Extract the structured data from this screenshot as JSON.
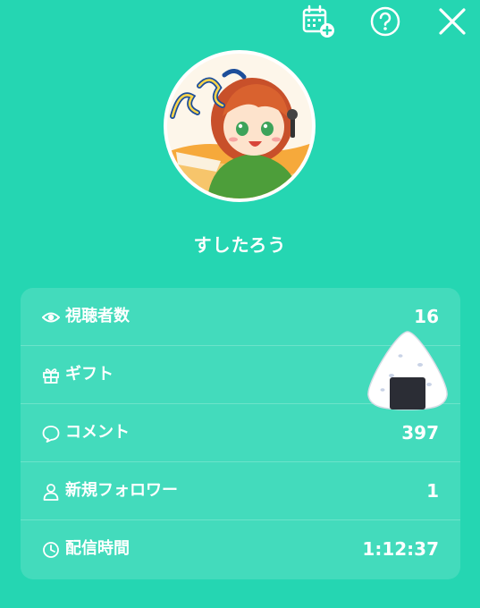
{
  "header": {
    "calendar_icon": "calendar-add-icon",
    "help_icon": "question-circle-icon",
    "close_icon": "close-x-icon"
  },
  "profile": {
    "username": "すしたろう",
    "avatar_text": "すしたろう"
  },
  "stats": [
    {
      "icon": "eye-icon",
      "label": "視聴者数",
      "value": "16"
    },
    {
      "icon": "gift-icon",
      "label": "ギフト",
      "value": ""
    },
    {
      "icon": "comment-icon",
      "label": "コメント",
      "value": "397"
    },
    {
      "icon": "person-icon",
      "label": "新規フォロワー",
      "value": "1"
    },
    {
      "icon": "clock-icon",
      "label": "配信時間",
      "value": "1:12:37"
    }
  ],
  "overlay": {
    "icon": "onigiri-icon"
  },
  "colors": {
    "background": "#25d6b2",
    "card": "#4fe0c3",
    "text": "#ffffff"
  }
}
